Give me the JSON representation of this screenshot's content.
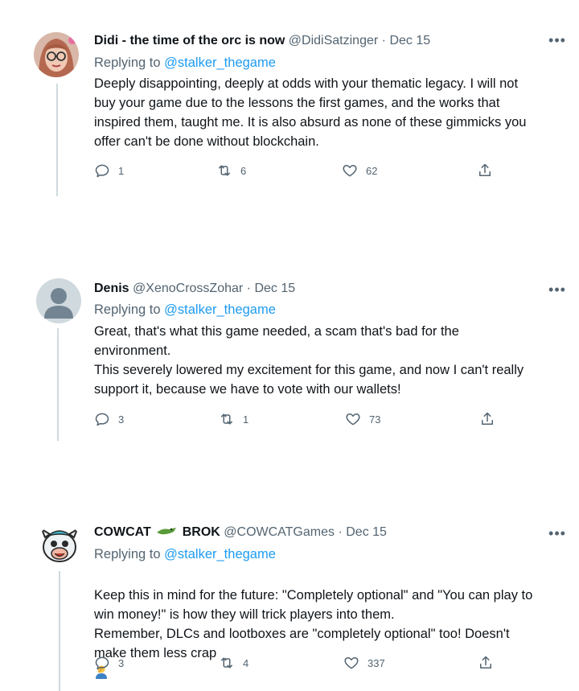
{
  "colors": {
    "text": "#0f1419",
    "secondary": "#536471",
    "link": "#1d9bf0",
    "thread_line": "#cfd9de"
  },
  "tweets": [
    {
      "display_name": "Didi - the time of the orc is now",
      "handle": "@DidiSatzinger",
      "separator": "·",
      "date": "Dec 15",
      "more_icon": "more-horizontal-icon",
      "replying_prefix": "Replying to",
      "replying_mention": "@stalker_thegame",
      "body": "Deeply disappointing, deeply at odds with your thematic legacy. I will not\nbuy your game due to the lessons the first games, and the works that\ninspired them, taught me. It is also absurd as none of these gimmicks you\noffer can't be done without blockchain.",
      "replies": "1",
      "retweets": "6",
      "likes": "62"
    },
    {
      "display_name": "Denis",
      "handle": "@XenoCrossZohar",
      "separator": "·",
      "date": "Dec 15",
      "more_icon": "more-horizontal-icon",
      "replying_prefix": "Replying to",
      "replying_mention": "@stalker_thegame",
      "body": "Great, that's what this game needed, a scam that's bad for the\nenvironment.\nThis severely lowered my excitement for this game, and now I can't really\nsupport it, because we have to vote with our wallets!",
      "replies": "3",
      "retweets": "1",
      "likes": "73"
    },
    {
      "display_name_part1": "COWCAT",
      "display_name_part2": "BROK",
      "handle": "@COWCATGames",
      "separator": "·",
      "date": "Dec 15",
      "more_icon": "more-horizontal-icon",
      "replying_prefix": "Replying to",
      "replying_mention": "@stalker_thegame",
      "body": "Keep this in mind for the future: \"Completely optional\" and \"You can play to\nwin money!\" is how they will trick players into them.\nRemember, DLCs and lootboxes are \"completely optional\" too! Doesn't\nmake them less crap",
      "replies": "3",
      "retweets": "4",
      "likes": "337"
    }
  ],
  "icons": {
    "reply": "reply-icon",
    "retweet": "retweet-icon",
    "like": "heart-icon",
    "share": "share-icon"
  }
}
